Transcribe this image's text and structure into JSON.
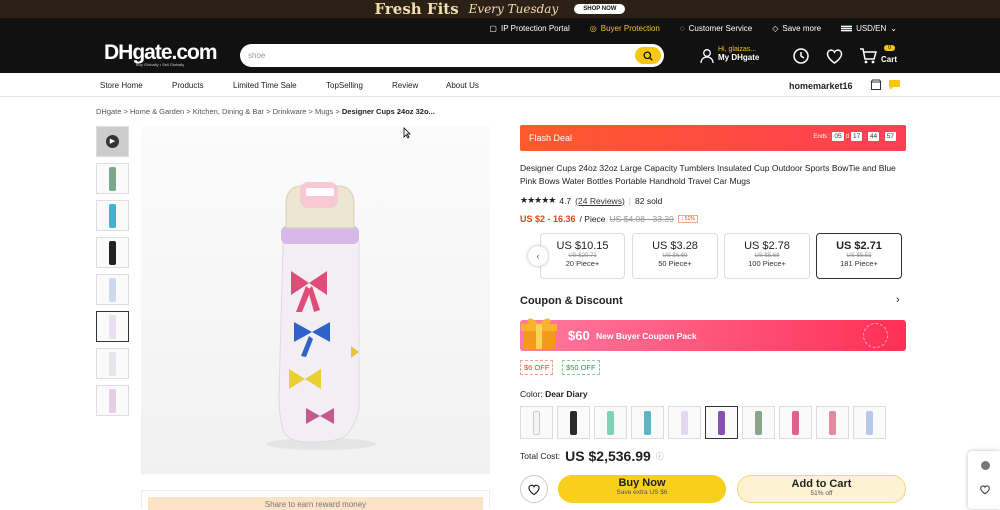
{
  "promo": {
    "title": "Fresh Fits",
    "subtitle": "Every Tuesday",
    "button": "SHOP NOW"
  },
  "util": {
    "ip": "IP Protection Portal",
    "buyer": "Buyer Protection",
    "care": "Customer Service",
    "save": "Save more",
    "currency": "USD/EN"
  },
  "header": {
    "logo": "DHgate.com",
    "logo_tagline": "Buy Globally • Sell Globally",
    "search_value": "shoe",
    "greeting": "Hi, glaizas...",
    "account": "My DHgate",
    "cart": "Cart",
    "cart_count": "0"
  },
  "nav": {
    "items": [
      "Store Home",
      "Products",
      "Limited Time Sale",
      "TopSelling",
      "Review",
      "About Us"
    ],
    "store": "homemarket16"
  },
  "breadcrumb": {
    "parts": [
      "DHgate",
      "Home & Garden",
      "Kitchen, Dining & Bar",
      "Drinkware",
      "Mugs"
    ],
    "current": "Designer Cups 24oz 32o..."
  },
  "reward": "Share to earn reward money",
  "flash": {
    "label": "Flash Deal",
    "ends": "Ends :",
    "d": "05",
    "dl": "d",
    "h": "17",
    "m": "44",
    "s": "57"
  },
  "product": {
    "title": "Designer Cups 24oz 32oz Large Capacity Tumblers Insulated Cup Outdoor Sports BowTie and Blue Pink Bows Water Bottles Portable Handhold Travel Car Mugs",
    "rating": "4.7",
    "reviews": "(24 Reviews)",
    "sold": "82 sold",
    "price": "US $2 - 16.36",
    "per": "/ Piece",
    "orig": "US $4.08 - 33.39",
    "off": "↓ 51%"
  },
  "tiers": [
    {
      "price": "US $10.15",
      "orig": "US $20.71",
      "qty": "20 Piece+"
    },
    {
      "price": "US $3.28",
      "orig": "US $6.69",
      "qty": "50 Piece+"
    },
    {
      "price": "US $2.78",
      "orig": "US $5.68",
      "qty": "100 Piece+"
    },
    {
      "price": "US $2.71",
      "orig": "US $5.53",
      "qty": "181 Piece+"
    }
  ],
  "coupon": {
    "heading": "Coupon & Discount",
    "amount": "$60",
    "pack": "New Buyer Coupon Pack",
    "tag1": "$6 OFF",
    "tag2": "$50 OFF"
  },
  "color": {
    "label": "Color:",
    "value": "Dear Diary"
  },
  "swatch_colors": [
    "#f4f4f4",
    "#2a2a2a",
    "#7fd1b8",
    "#5ab6c2",
    "#e6d6ee",
    "#8a4fb0",
    "#8aa58a",
    "#e0608c",
    "#e58a9e",
    "#b9c8e6"
  ],
  "total": {
    "label": "Total Cost:",
    "value": "US $2,536.99"
  },
  "buy": {
    "label": "Buy Now",
    "sub": "Save extra US $6"
  },
  "add": {
    "label": "Add to Cart",
    "sub": "51% off"
  },
  "colors": {
    "accent": "#f6c80f",
    "flash": "#ff4a3a",
    "price": "#e8411d"
  }
}
